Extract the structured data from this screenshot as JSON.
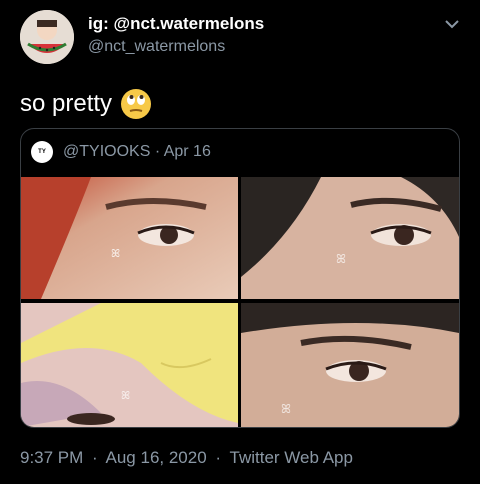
{
  "header": {
    "display_name": "ig: @nct.watermelons",
    "handle": "@nct_watermelons",
    "avatar_icon": "watermelon-avatar-icon",
    "menu_icon": "chevron-down-icon"
  },
  "tweet": {
    "text": "so pretty",
    "emoji": "face-with-rolling-eyes-emoji"
  },
  "quote": {
    "avatar_text": "TY",
    "author_meta": "@TYIOOKS · Apr 16",
    "images": [
      "eye-closeup-red-hair",
      "eye-closeup-dark-hair",
      "yellow-cap-closeup",
      "eye-closeup-side-profile"
    ]
  },
  "footer": {
    "time": "9:37 PM",
    "date": "Aug 16, 2020",
    "separator": "·",
    "source": "Twitter Web App"
  },
  "colors": {
    "background": "#000000",
    "text": "#ffffff",
    "muted": "#8b98a5",
    "border": "#3a3f44"
  }
}
